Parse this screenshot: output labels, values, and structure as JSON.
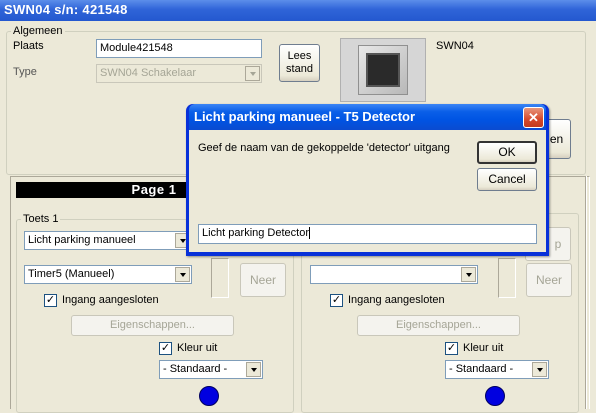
{
  "window": {
    "title": "SWN04 s/n: 421548"
  },
  "algemeen": {
    "legend": "Algemeen",
    "plaats_label": "Plaats",
    "plaats_value": "Module421548",
    "type_label": "Type",
    "type_value": "SWN04 Schakelaar",
    "lees_stand_label": "Lees\nstand",
    "device_caption": "SWN04",
    "partial_button_label": "en"
  },
  "page": {
    "header": "Page 1"
  },
  "left_panel": {
    "legend": "Toets 1",
    "name_value": "Licht parking manueel",
    "timer_value": "Timer5 (Manueel)",
    "ingang_label": "Ingang aangesloten",
    "ingang_checked": "✓",
    "eigenschappen_label": "Eigenschappen...",
    "neer_label": "Neer",
    "kleur_label": "Kleur uit",
    "kleur_checked": "✓",
    "kleur_value": "- Standaard -",
    "led_color": "#0000e0"
  },
  "right_panel": {
    "op_label": "p",
    "timer_value": "",
    "ingang_label": "Ingang aangesloten",
    "ingang_checked": "✓",
    "eigenschappen_label": "Eigenschappen...",
    "neer_label": "Neer",
    "kleur_label": "Kleur uit",
    "kleur_checked": "✓",
    "kleur_value": "- Standaard -",
    "led_color": "#0000e0"
  },
  "dialog": {
    "title": "Licht parking manueel - T5 Detector",
    "close_glyph": "✕",
    "prompt": "Geef de naam van de gekoppelde 'detector' uitgang",
    "ok_label": "OK",
    "cancel_label": "Cancel",
    "input_value": "Licht parking Detector"
  }
}
